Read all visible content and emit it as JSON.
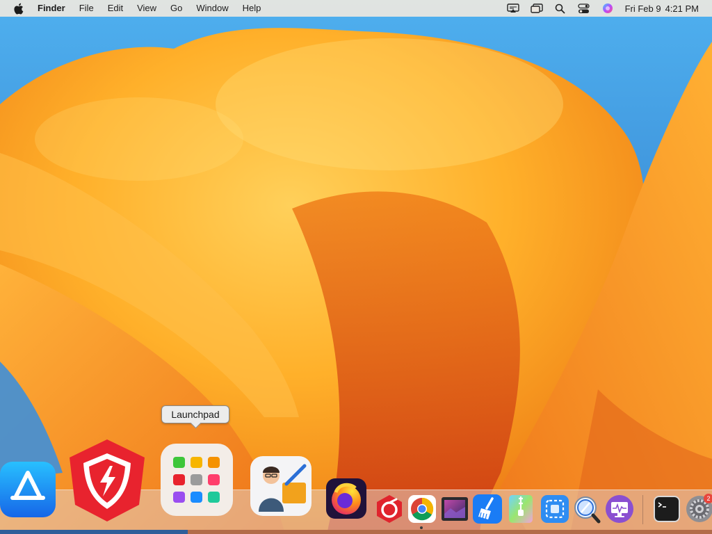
{
  "menubar": {
    "app_name": "Finder",
    "menus": [
      "File",
      "Edit",
      "View",
      "Go",
      "Window",
      "Help"
    ],
    "clock": {
      "date": "Fri Feb 9",
      "time": "4:21 PM"
    },
    "status_icons": [
      "screen-mirroring-icon",
      "stage-manager-icon",
      "spotlight-search-icon",
      "control-center-icon",
      "siri-icon"
    ]
  },
  "tooltip": {
    "label": "Launchpad"
  },
  "dock": {
    "items": [
      {
        "name": "App Store",
        "icon": "app-store-icon"
      },
      {
        "name": "Security",
        "icon": "shield-bolt-icon"
      },
      {
        "name": "Launchpad",
        "icon": "launchpad-icon"
      },
      {
        "name": "Cleaner",
        "icon": "cleaner-man-icon"
      },
      {
        "name": "Firefox",
        "icon": "firefox-icon"
      },
      {
        "name": "Cleanup",
        "icon": "red-hexagon-icon"
      },
      {
        "name": "Chrome",
        "icon": "chrome-icon",
        "running": true
      },
      {
        "name": "Photo Viewer",
        "icon": "photo-frame-icon"
      },
      {
        "name": "Cleaner Broom",
        "icon": "broom-icon"
      },
      {
        "name": "Archiver",
        "icon": "zip-archive-icon"
      },
      {
        "name": "Screenshot",
        "icon": "screenshot-icon"
      },
      {
        "name": "Directory Utility",
        "icon": "magnifier-icon"
      },
      {
        "name": "System Monitor",
        "icon": "monitor-icon"
      },
      {
        "name": "Terminal",
        "icon": "terminal-icon"
      },
      {
        "name": "System Settings",
        "icon": "gear-icon",
        "badge": "2"
      }
    ]
  },
  "colors": {
    "menubar_bg": "#ECE7E0",
    "wallpaper_sky": "#3C8FD8",
    "wallpaper_orange": "#F5A21E",
    "wallpaper_red": "#D4481A"
  }
}
